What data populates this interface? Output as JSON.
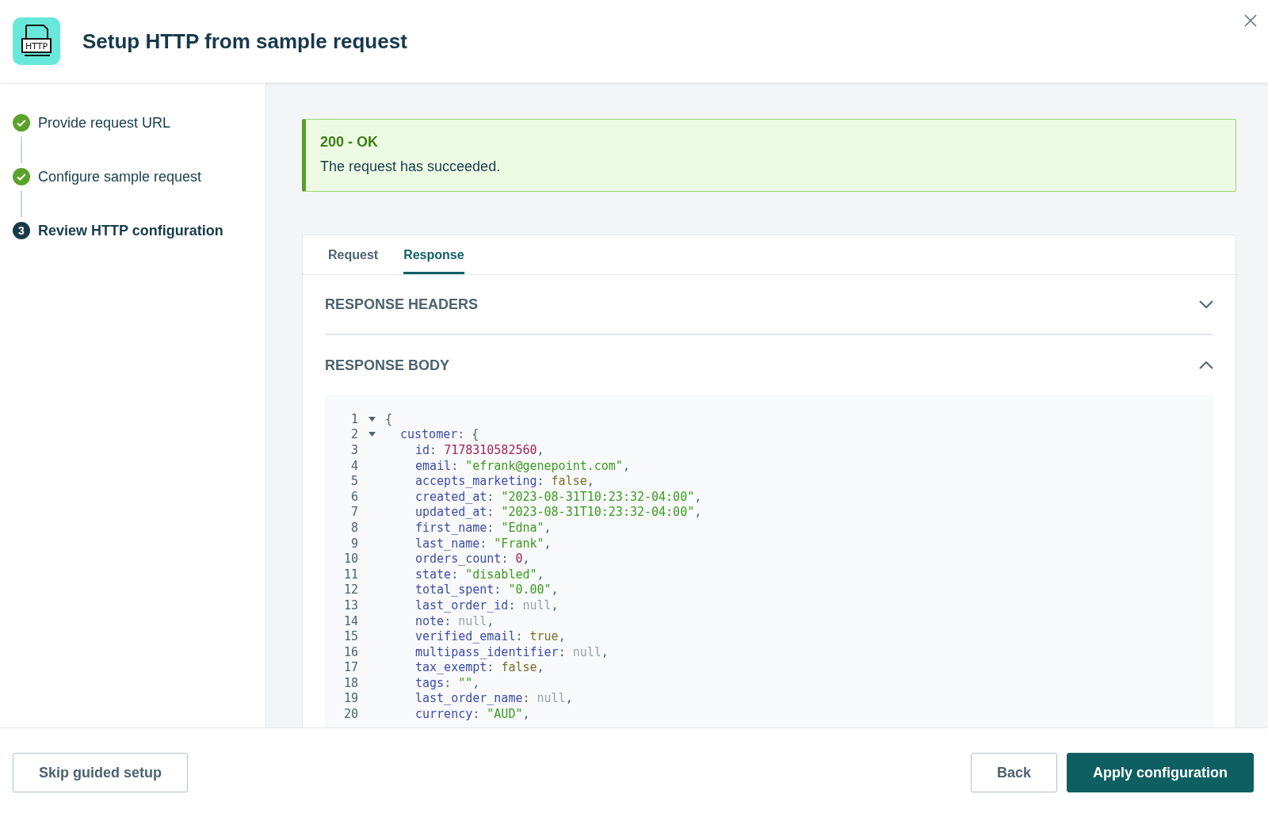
{
  "header": {
    "title": "Setup HTTP from sample request",
    "logo_text": "HTTP"
  },
  "steps": [
    {
      "label": "Provide request URL",
      "completed": true
    },
    {
      "label": "Configure sample request",
      "completed": true
    },
    {
      "label": "Review HTTP configuration",
      "completed": false,
      "marker": "3"
    }
  ],
  "alert": {
    "title": "200 - OK",
    "message": "The request has succeeded."
  },
  "tabs": [
    {
      "label": "Request",
      "selected": false
    },
    {
      "label": "Response",
      "selected": true
    }
  ],
  "sections": [
    {
      "title": "RESPONSE HEADERS",
      "expanded": false
    },
    {
      "title": "RESPONSE BODY",
      "expanded": true
    }
  ],
  "code": [
    {
      "number": "1",
      "expanded": true,
      "tokens": [
        {
          "kind": "punct",
          "text": "{"
        }
      ],
      "children": [
        {
          "number": "2",
          "expanded": true,
          "tokens": [
            {
              "kind": "key",
              "text": "customer"
            },
            {
              "kind": "punct",
              "text": ": {"
            }
          ],
          "children": [
            {
              "number": "3",
              "tokens": [
                {
                  "kind": "key",
                  "text": "id"
                },
                {
                  "kind": "punct",
                  "text": ": "
                },
                {
                  "kind": "number",
                  "text": "7178310582560"
                },
                {
                  "kind": "punct",
                  "text": ","
                }
              ]
            },
            {
              "number": "4",
              "tokens": [
                {
                  "kind": "key",
                  "text": "email"
                },
                {
                  "kind": "punct",
                  "text": ": "
                },
                {
                  "kind": "string",
                  "text": "\"efrank@genepoint.com\""
                },
                {
                  "kind": "punct",
                  "text": ","
                }
              ]
            },
            {
              "number": "5",
              "tokens": [
                {
                  "kind": "key",
                  "text": "accepts_marketing"
                },
                {
                  "kind": "punct",
                  "text": ": "
                },
                {
                  "kind": "bool",
                  "text": "false"
                },
                {
                  "kind": "punct",
                  "text": ","
                }
              ]
            },
            {
              "number": "6",
              "tokens": [
                {
                  "kind": "key",
                  "text": "created_at"
                },
                {
                  "kind": "punct",
                  "text": ": "
                },
                {
                  "kind": "string",
                  "text": "\"2023-08-31T10:23:32-04:00\""
                },
                {
                  "kind": "punct",
                  "text": ","
                }
              ]
            },
            {
              "number": "7",
              "tokens": [
                {
                  "kind": "key",
                  "text": "updated_at"
                },
                {
                  "kind": "punct",
                  "text": ": "
                },
                {
                  "kind": "string",
                  "text": "\"2023-08-31T10:23:32-04:00\""
                },
                {
                  "kind": "punct",
                  "text": ","
                }
              ]
            },
            {
              "number": "8",
              "tokens": [
                {
                  "kind": "key",
                  "text": "first_name"
                },
                {
                  "kind": "punct",
                  "text": ": "
                },
                {
                  "kind": "string",
                  "text": "\"Edna\""
                },
                {
                  "kind": "punct",
                  "text": ","
                }
              ]
            },
            {
              "number": "9",
              "tokens": [
                {
                  "kind": "key",
                  "text": "last_name"
                },
                {
                  "kind": "punct",
                  "text": ": "
                },
                {
                  "kind": "string",
                  "text": "\"Frank\""
                },
                {
                  "kind": "punct",
                  "text": ","
                }
              ]
            },
            {
              "number": "10",
              "tokens": [
                {
                  "kind": "key",
                  "text": "orders_count"
                },
                {
                  "kind": "punct",
                  "text": ": "
                },
                {
                  "kind": "number",
                  "text": "0"
                },
                {
                  "kind": "punct",
                  "text": ","
                }
              ]
            },
            {
              "number": "11",
              "tokens": [
                {
                  "kind": "key",
                  "text": "state"
                },
                {
                  "kind": "punct",
                  "text": ": "
                },
                {
                  "kind": "string",
                  "text": "\"disabled\""
                },
                {
                  "kind": "punct",
                  "text": ","
                }
              ]
            },
            {
              "number": "12",
              "tokens": [
                {
                  "kind": "key",
                  "text": "total_spent"
                },
                {
                  "kind": "punct",
                  "text": ": "
                },
                {
                  "kind": "string",
                  "text": "\"0.00\""
                },
                {
                  "kind": "punct",
                  "text": ","
                }
              ]
            },
            {
              "number": "13",
              "tokens": [
                {
                  "kind": "key",
                  "text": "last_order_id"
                },
                {
                  "kind": "punct",
                  "text": ": "
                },
                {
                  "kind": "null",
                  "text": "null"
                },
                {
                  "kind": "punct",
                  "text": ","
                }
              ]
            },
            {
              "number": "14",
              "tokens": [
                {
                  "kind": "key",
                  "text": "note"
                },
                {
                  "kind": "punct",
                  "text": ": "
                },
                {
                  "kind": "null",
                  "text": "null"
                },
                {
                  "kind": "punct",
                  "text": ","
                }
              ]
            },
            {
              "number": "15",
              "tokens": [
                {
                  "kind": "key",
                  "text": "verified_email"
                },
                {
                  "kind": "punct",
                  "text": ": "
                },
                {
                  "kind": "bool",
                  "text": "true"
                },
                {
                  "kind": "punct",
                  "text": ","
                }
              ]
            },
            {
              "number": "16",
              "tokens": [
                {
                  "kind": "key",
                  "text": "multipass_identifier"
                },
                {
                  "kind": "punct",
                  "text": ": "
                },
                {
                  "kind": "null",
                  "text": "null"
                },
                {
                  "kind": "punct",
                  "text": ","
                }
              ]
            },
            {
              "number": "17",
              "tokens": [
                {
                  "kind": "key",
                  "text": "tax_exempt"
                },
                {
                  "kind": "punct",
                  "text": ": "
                },
                {
                  "kind": "bool",
                  "text": "false"
                },
                {
                  "kind": "punct",
                  "text": ","
                }
              ]
            },
            {
              "number": "18",
              "tokens": [
                {
                  "kind": "key",
                  "text": "tags"
                },
                {
                  "kind": "punct",
                  "text": ": "
                },
                {
                  "kind": "string",
                  "text": "\"\""
                },
                {
                  "kind": "punct",
                  "text": ","
                }
              ]
            },
            {
              "number": "19",
              "tokens": [
                {
                  "kind": "key",
                  "text": "last_order_name"
                },
                {
                  "kind": "punct",
                  "text": ": "
                },
                {
                  "kind": "null",
                  "text": "null"
                },
                {
                  "kind": "punct",
                  "text": ","
                }
              ]
            },
            {
              "number": "20",
              "tokens": [
                {
                  "kind": "key",
                  "text": "currency"
                },
                {
                  "kind": "punct",
                  "text": ": "
                },
                {
                  "kind": "string",
                  "text": "\"AUD\""
                },
                {
                  "kind": "punct",
                  "text": ","
                }
              ]
            }
          ]
        }
      ]
    }
  ],
  "footer": {
    "skip_button": "Skip guided setup",
    "back_button": "Back",
    "apply_button": "Apply configuration"
  }
}
